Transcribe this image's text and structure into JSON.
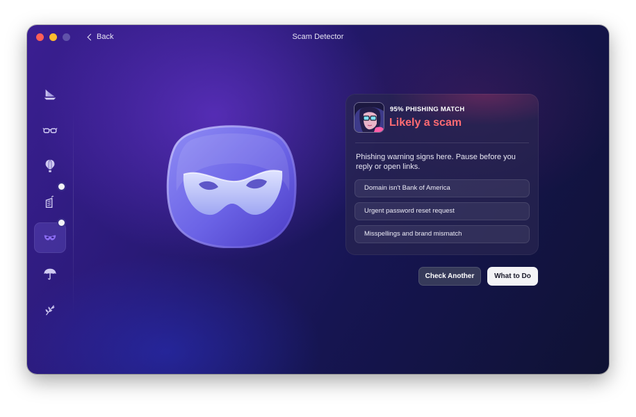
{
  "window": {
    "title": "Scam Detector",
    "back_label": "Back"
  },
  "sidebar": {
    "items": [
      {
        "icon": "sailboat-icon",
        "active": false,
        "badge": false
      },
      {
        "icon": "glasses-icon",
        "active": false,
        "badge": false
      },
      {
        "icon": "hot-air-balloon-icon",
        "active": false,
        "badge": false
      },
      {
        "icon": "building-icon",
        "active": false,
        "badge": true
      },
      {
        "icon": "mask-icon",
        "active": true,
        "badge": true
      },
      {
        "icon": "umbrella-icon",
        "active": false,
        "badge": false
      },
      {
        "icon": "plant-icon",
        "active": false,
        "badge": false
      }
    ]
  },
  "hero": {
    "icon": "mask-icon"
  },
  "result": {
    "match_label": "95% PHISHING MATCH",
    "verdict": "Likely a scam",
    "description": "Phishing warning signs here. Pause before you reply or open links.",
    "signs": [
      "Domain isn't Bank of America",
      "Urgent password reset request",
      "Misspellings and brand mismatch"
    ],
    "verdict_color": "#ff6b72"
  },
  "actions": {
    "secondary_label": "Check Another",
    "primary_label": "What to Do"
  }
}
